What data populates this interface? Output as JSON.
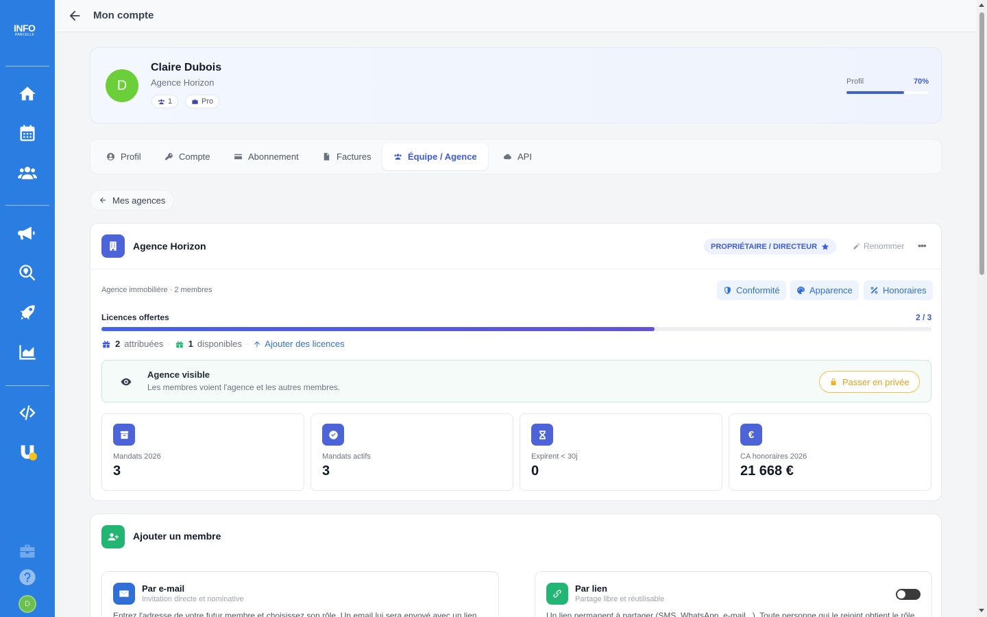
{
  "app": {
    "logo_main": "INFO",
    "logo_sub": "PARCELLE",
    "page_title": "Mon compte",
    "user_initial": "D"
  },
  "profile": {
    "initial": "D",
    "name": "Claire Dubois",
    "agency": "Agence Horizon",
    "members_badge": "1",
    "plan_badge": "Pro",
    "progress_label": "Profil",
    "progress_pct": "70%",
    "progress_value": 0.7
  },
  "tabs": [
    {
      "label": "Profil",
      "icon": "user-circle-icon"
    },
    {
      "label": "Compte",
      "icon": "key-icon"
    },
    {
      "label": "Abonnement",
      "icon": "card-icon"
    },
    {
      "label": "Factures",
      "icon": "file-icon"
    },
    {
      "label": "Équipe / Agence",
      "icon": "users-icon",
      "active": true
    },
    {
      "label": "API",
      "icon": "cloud-icon"
    }
  ],
  "back_link": "Mes agences",
  "agency": {
    "name": "Agence Horizon",
    "role": "PROPRIÉTAIRE / DIRECTEUR",
    "rename": "Renommer",
    "more": "•••",
    "subtitle": "Agence immobilière · 2 membres",
    "actions": [
      "Conformité",
      "Apparence",
      "Honoraires"
    ],
    "licences": {
      "label": "Licences offertes",
      "count": "2 / 3",
      "used": 2,
      "total": 3,
      "assigned_num": "2",
      "assigned_text": "attribuées",
      "available_num": "1",
      "available_text": "disponibles",
      "add_text": "Ajouter des licences"
    },
    "visibility": {
      "title": "Agence visible",
      "description": "Les membres voient l'agence et les autres membres.",
      "button": "Passer en privée"
    },
    "stats": [
      {
        "label": "Mandats 2026",
        "value": "3",
        "icon": "archive-icon"
      },
      {
        "label": "Mandats actifs",
        "value": "3",
        "icon": "check-circle-icon"
      },
      {
        "label": "Expirent < 30j",
        "value": "0",
        "icon": "hourglass-icon"
      },
      {
        "label": "CA honoraires 2026",
        "value": "21 668 €",
        "icon": "euro-icon"
      }
    ]
  },
  "add_member": {
    "title": "Ajouter un membre",
    "email": {
      "title": "Par e-mail",
      "subtitle": "Invitation directe et nominative",
      "description": "Entrez l'adresse de votre futur membre et choisissez son rôle. Un email lui sera envoyé avec un lien"
    },
    "link": {
      "title": "Par lien",
      "subtitle": "Partage libre et réutilisable",
      "description": "Un lien permanent à partager (SMS, WhatsApp, e-mail...). Toute personne qui le rejoint obtient le rôle",
      "enabled": false
    }
  },
  "colors": {
    "sidebar": "#2a7de1",
    "accent": "#3b5bdb",
    "success": "#22b573",
    "warning": "#f0b32a"
  }
}
